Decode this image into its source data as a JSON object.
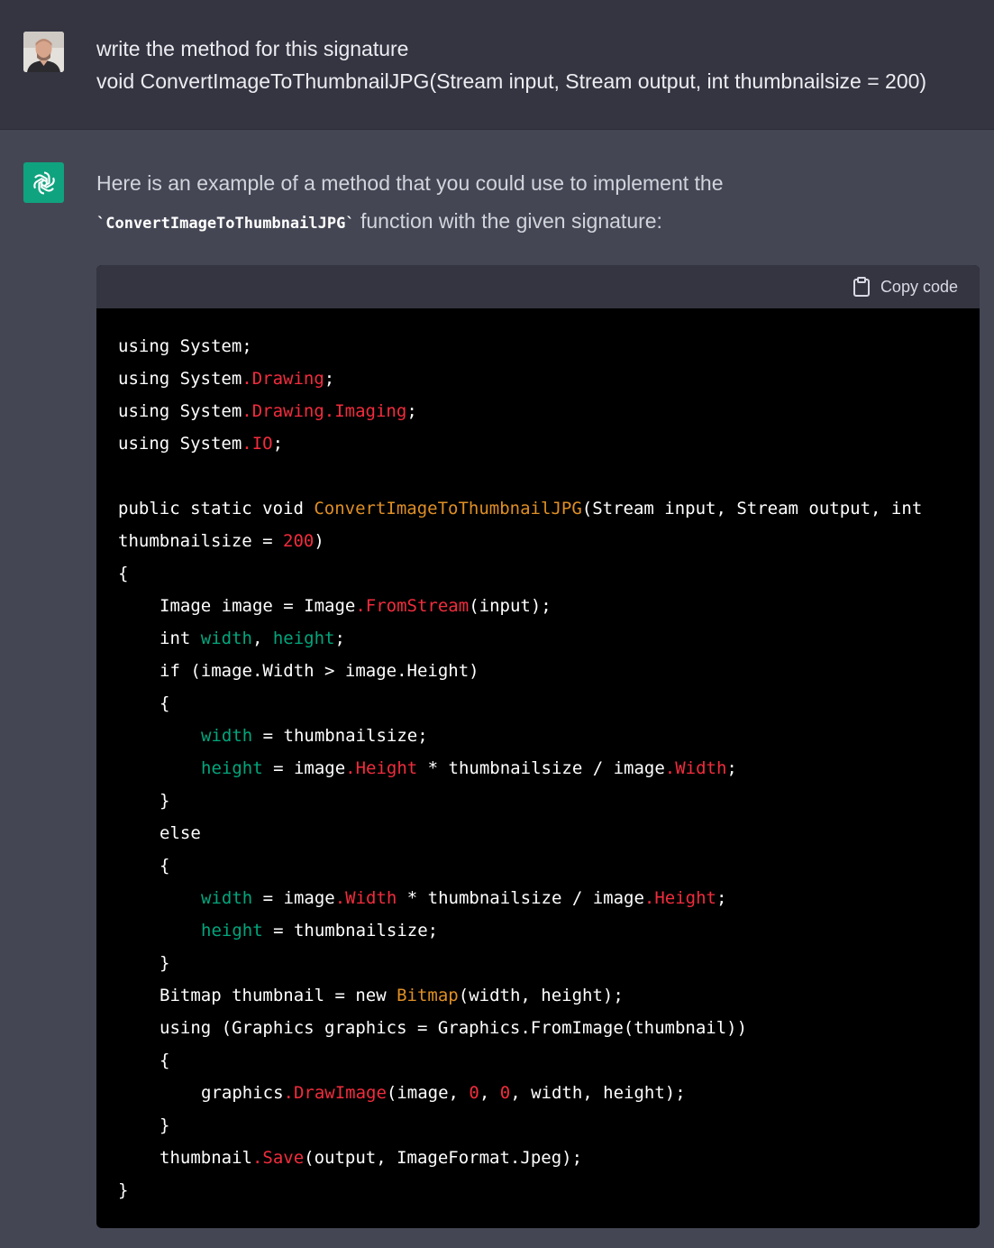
{
  "user_message": {
    "line1": "write the method for this signature",
    "line2": "void ConvertImageToThumbnailJPG(Stream input, Stream output, int thumbnailsize = 200)"
  },
  "assistant": {
    "intro_part1": "Here is an example of a method that you could use to implement the",
    "inline_code": "`ConvertImageToThumbnailJPG`",
    "intro_part2": " function with the given signature:"
  },
  "code_block": {
    "copy_label": "Copy code",
    "lines": [
      {
        "indent": 0,
        "tokens": [
          {
            "t": "using System;",
            "c": ""
          }
        ]
      },
      {
        "indent": 0,
        "tokens": [
          {
            "t": "using System",
            "c": ""
          },
          {
            "t": ".Drawing",
            "c": "red"
          },
          {
            "t": ";",
            "c": ""
          }
        ]
      },
      {
        "indent": 0,
        "tokens": [
          {
            "t": "using System",
            "c": ""
          },
          {
            "t": ".Drawing.Imaging",
            "c": "red"
          },
          {
            "t": ";",
            "c": ""
          }
        ]
      },
      {
        "indent": 0,
        "tokens": [
          {
            "t": "using System",
            "c": ""
          },
          {
            "t": ".IO",
            "c": "red"
          },
          {
            "t": ";",
            "c": ""
          }
        ]
      },
      {
        "indent": 0,
        "tokens": [
          {
            "t": "",
            "c": ""
          }
        ]
      },
      {
        "indent": 0,
        "tokens": [
          {
            "t": "public static void ",
            "c": ""
          },
          {
            "t": "ConvertImageToThumbnailJPG",
            "c": "orange"
          },
          {
            "t": "(Stream input, Stream output, int",
            "c": ""
          }
        ]
      },
      {
        "indent": 0,
        "tokens": [
          {
            "t": "thumbnailsize = ",
            "c": ""
          },
          {
            "t": "200",
            "c": "red"
          },
          {
            "t": ")",
            "c": ""
          }
        ]
      },
      {
        "indent": 0,
        "tokens": [
          {
            "t": "{",
            "c": ""
          }
        ]
      },
      {
        "indent": 1,
        "tokens": [
          {
            "t": "Image image = Image",
            "c": ""
          },
          {
            "t": ".FromStream",
            "c": "red"
          },
          {
            "t": "(input);",
            "c": ""
          }
        ]
      },
      {
        "indent": 1,
        "tokens": [
          {
            "t": "int ",
            "c": ""
          },
          {
            "t": "width",
            "c": "green"
          },
          {
            "t": ", ",
            "c": ""
          },
          {
            "t": "height",
            "c": "green"
          },
          {
            "t": ";",
            "c": ""
          }
        ]
      },
      {
        "indent": 1,
        "tokens": [
          {
            "t": "if (image.Width > image.Height)",
            "c": ""
          }
        ]
      },
      {
        "indent": 1,
        "tokens": [
          {
            "t": "{",
            "c": ""
          }
        ]
      },
      {
        "indent": 2,
        "tokens": [
          {
            "t": "width",
            "c": "green"
          },
          {
            "t": " = thumbnailsize;",
            "c": ""
          }
        ]
      },
      {
        "indent": 2,
        "tokens": [
          {
            "t": "height",
            "c": "green"
          },
          {
            "t": " = image",
            "c": ""
          },
          {
            "t": ".Height",
            "c": "red"
          },
          {
            "t": " * thumbnailsize / image",
            "c": ""
          },
          {
            "t": ".Width",
            "c": "red"
          },
          {
            "t": ";",
            "c": ""
          }
        ]
      },
      {
        "indent": 1,
        "tokens": [
          {
            "t": "}",
            "c": ""
          }
        ]
      },
      {
        "indent": 1,
        "tokens": [
          {
            "t": "else",
            "c": ""
          }
        ]
      },
      {
        "indent": 1,
        "tokens": [
          {
            "t": "{",
            "c": ""
          }
        ]
      },
      {
        "indent": 2,
        "tokens": [
          {
            "t": "width",
            "c": "green"
          },
          {
            "t": " = image",
            "c": ""
          },
          {
            "t": ".Width",
            "c": "red"
          },
          {
            "t": " * thumbnailsize / image",
            "c": ""
          },
          {
            "t": ".Height",
            "c": "red"
          },
          {
            "t": ";",
            "c": ""
          }
        ]
      },
      {
        "indent": 2,
        "tokens": [
          {
            "t": "height",
            "c": "green"
          },
          {
            "t": " = thumbnailsize;",
            "c": ""
          }
        ]
      },
      {
        "indent": 1,
        "tokens": [
          {
            "t": "}",
            "c": ""
          }
        ]
      },
      {
        "indent": 1,
        "tokens": [
          {
            "t": "Bitmap thumbnail = new ",
            "c": ""
          },
          {
            "t": "Bitmap",
            "c": "orange"
          },
          {
            "t": "(width, height);",
            "c": ""
          }
        ]
      },
      {
        "indent": 1,
        "tokens": [
          {
            "t": "using (Graphics graphics = Graphics.FromImage(thumbnail))",
            "c": ""
          }
        ]
      },
      {
        "indent": 1,
        "tokens": [
          {
            "t": "{",
            "c": ""
          }
        ]
      },
      {
        "indent": 2,
        "tokens": [
          {
            "t": "graphics",
            "c": ""
          },
          {
            "t": ".DrawImage",
            "c": "red"
          },
          {
            "t": "(image, ",
            "c": ""
          },
          {
            "t": "0",
            "c": "red"
          },
          {
            "t": ", ",
            "c": ""
          },
          {
            "t": "0",
            "c": "red"
          },
          {
            "t": ", width, height);",
            "c": ""
          }
        ]
      },
      {
        "indent": 1,
        "tokens": [
          {
            "t": "}",
            "c": ""
          }
        ]
      },
      {
        "indent": 1,
        "tokens": [
          {
            "t": "thumbnail",
            "c": ""
          },
          {
            "t": ".Save",
            "c": "red"
          },
          {
            "t": "(output, ImageFormat.Jpeg);",
            "c": ""
          }
        ]
      },
      {
        "indent": 0,
        "tokens": [
          {
            "t": "}",
            "c": ""
          }
        ]
      }
    ]
  },
  "colors": {
    "user_bg": "#343541",
    "assistant_bg": "#444654",
    "code_bg": "#000000",
    "code_header_bg": "#343541",
    "token_red": "#f22c3d",
    "token_orange": "#df8f25",
    "token_green": "#00a67d",
    "avatar_green": "#10a37f"
  },
  "icons": {
    "user_avatar": "user-avatar-photo",
    "assistant_avatar": "openai-logo-icon",
    "copy": "clipboard-icon"
  }
}
